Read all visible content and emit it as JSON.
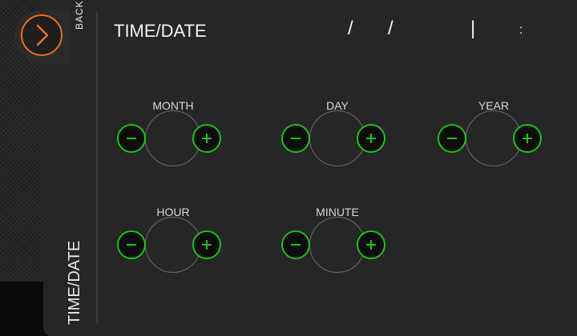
{
  "back": {
    "label": "BACK",
    "icon": "chevron-right-icon",
    "accent": "#e8701e"
  },
  "sidebar": {
    "title": "TIME/DATE"
  },
  "header": {
    "title": "TIME/DATE",
    "date_sep_1": "/",
    "date_sep_2": "/",
    "divider": "|",
    "time_sep": ":"
  },
  "colors": {
    "button_accent": "#19c419",
    "panel": "#262626"
  },
  "controls": [
    {
      "label": "MONTH",
      "value": "",
      "minus_icon": "minus-icon",
      "plus_icon": "plus-icon"
    },
    {
      "label": "DAY",
      "value": "",
      "minus_icon": "minus-icon",
      "plus_icon": "plus-icon"
    },
    {
      "label": "YEAR",
      "value": "",
      "minus_icon": "minus-icon",
      "plus_icon": "plus-icon"
    },
    {
      "label": "HOUR",
      "value": "",
      "minus_icon": "minus-icon",
      "plus_icon": "plus-icon"
    },
    {
      "label": "MINUTE",
      "value": "",
      "minus_icon": "minus-icon",
      "plus_icon": "plus-icon"
    }
  ]
}
